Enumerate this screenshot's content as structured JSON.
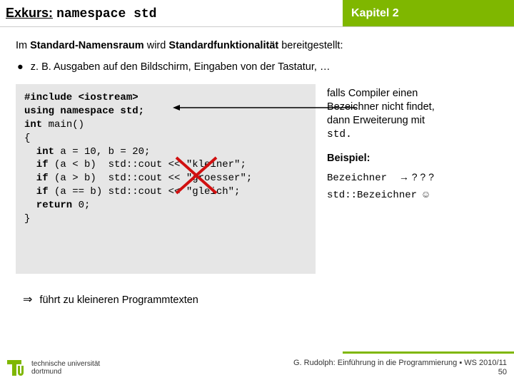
{
  "header": {
    "title_prefix": "Exkurs:",
    "title_code": "namespace std",
    "chapter": "Kapitel 2"
  },
  "intro": {
    "part1": "Im ",
    "bold1": "Standard-Namensraum",
    "part2": " wird ",
    "bold2": "Standardfunktionalität",
    "part3": " bereitgestellt:"
  },
  "bullet": "z. B. Ausgaben auf den Bildschirm, Eingaben von der Tastatur, …",
  "code": {
    "l1a": "#include <iostream>",
    "l2a": "using namespace std;",
    "l3a": "int",
    "l3b": " main()",
    "l4": "{",
    "l5a": "  int",
    "l5b": " a = 10, b = 20;",
    "l6a": "  if",
    "l6b": " (a < b)  std::cout << \"kleiner\";",
    "l7a": "  if",
    "l7b": " (a > b)  std::cout << \"groesser\";",
    "l8a": "  if",
    "l8b": " (a == b) std::cout << \"gleich\";",
    "l9a": "  return",
    "l9b": " 0;",
    "l10": "}"
  },
  "note": {
    "line1": "falls Compiler einen",
    "line2": "Bezeichner nicht findet,",
    "line3": "dann Erweiterung mit",
    "line4": "std."
  },
  "example": {
    "label": "Beispiel:",
    "row1a": "Bezeichner",
    "row1b": "→ ? ? ?",
    "row2": "std::Bezeichner ☺"
  },
  "conclusion": "führt zu kleineren Programmtexten",
  "footer": {
    "uni1": "technische universität",
    "uni2": "dortmund",
    "credit": "G. Rudolph: Einführung in die Programmierung ▪ WS 2010/11",
    "page": "50"
  }
}
